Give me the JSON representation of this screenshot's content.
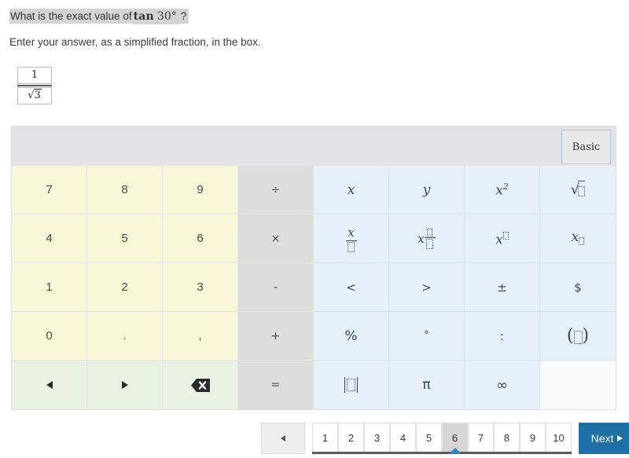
{
  "question": {
    "prefix": "What is the exact value of",
    "function": "tan",
    "angle": "30°",
    "qmark": "?",
    "instruction": "Enter your answer, as a simplified fraction, in the box."
  },
  "answer": {
    "numerator": "1",
    "denominator_radicand": "3",
    "denominator_prefix": "√"
  },
  "keypad": {
    "tab_label": "Basic",
    "rows": [
      [
        {
          "label": "7",
          "kind": "num",
          "name": "key-7"
        },
        {
          "label": "8",
          "kind": "num",
          "name": "key-8"
        },
        {
          "label": "9",
          "kind": "num",
          "name": "key-9"
        },
        {
          "label": "÷",
          "kind": "op",
          "name": "key-divide"
        },
        {
          "label": "x",
          "kind": "math",
          "name": "key-variable-x"
        },
        {
          "label": "y",
          "kind": "math",
          "name": "key-variable-y"
        },
        {
          "label": "x²",
          "kind": "math",
          "name": "key-x-squared"
        },
        {
          "label": "√□",
          "kind": "math",
          "name": "key-square-root"
        }
      ],
      [
        {
          "label": "4",
          "kind": "num",
          "name": "key-4"
        },
        {
          "label": "5",
          "kind": "num",
          "name": "key-5"
        },
        {
          "label": "6",
          "kind": "num",
          "name": "key-6"
        },
        {
          "label": "×",
          "kind": "op",
          "name": "key-multiply"
        },
        {
          "label": "x/□",
          "kind": "math",
          "name": "key-fraction-x-over-box"
        },
        {
          "label": "x □/□",
          "kind": "math",
          "name": "key-mixed-number"
        },
        {
          "label": "x^□",
          "kind": "math",
          "name": "key-exponent"
        },
        {
          "label": "x_□",
          "kind": "math",
          "name": "key-subscript"
        }
      ],
      [
        {
          "label": "1",
          "kind": "num",
          "name": "key-1"
        },
        {
          "label": "2",
          "kind": "num",
          "name": "key-2"
        },
        {
          "label": "3",
          "kind": "num",
          "name": "key-3"
        },
        {
          "label": "-",
          "kind": "op",
          "name": "key-minus"
        },
        {
          "label": "<",
          "kind": "math",
          "name": "key-less-than"
        },
        {
          "label": ">",
          "kind": "math",
          "name": "key-greater-than"
        },
        {
          "label": "±",
          "kind": "math",
          "name": "key-plus-minus"
        },
        {
          "label": "$",
          "kind": "math",
          "name": "key-dollar"
        }
      ],
      [
        {
          "label": "0",
          "kind": "num",
          "name": "key-0"
        },
        {
          "label": ".",
          "kind": "num",
          "name": "key-decimal-point"
        },
        {
          "label": ",",
          "kind": "num",
          "name": "key-comma"
        },
        {
          "label": "+",
          "kind": "op",
          "name": "key-plus"
        },
        {
          "label": "%",
          "kind": "math",
          "name": "key-percent"
        },
        {
          "label": "°",
          "kind": "math",
          "name": "key-degree"
        },
        {
          "label": ":",
          "kind": "math",
          "name": "key-colon"
        },
        {
          "label": "(□)",
          "kind": "math",
          "name": "key-parentheses"
        }
      ],
      [
        {
          "label": "◄",
          "kind": "nav",
          "name": "key-cursor-left"
        },
        {
          "label": "►",
          "kind": "nav",
          "name": "key-cursor-right"
        },
        {
          "label": "⌫",
          "kind": "nav",
          "name": "key-backspace"
        },
        {
          "label": "=",
          "kind": "op",
          "name": "key-equals"
        },
        {
          "label": "|□|",
          "kind": "math",
          "name": "key-absolute-value"
        },
        {
          "label": "π",
          "kind": "math",
          "name": "key-pi"
        },
        {
          "label": "∞",
          "kind": "math",
          "name": "key-infinity"
        },
        {
          "label": "",
          "kind": "blank",
          "name": "key-blank"
        }
      ]
    ]
  },
  "pagination": {
    "prev_label": "◄",
    "pages": [
      "1",
      "2",
      "3",
      "4",
      "5",
      "6",
      "7",
      "8",
      "9",
      "10"
    ],
    "active_page": "6",
    "next_label": "Next"
  },
  "colors": {
    "accent_blue": "#1d6fa5",
    "marker_blue": "#2e87c4",
    "number_key": "#f8f8d8",
    "operator_key": "#dddddd",
    "math_key": "#e6f0fa",
    "nav_key": "#eaf2e4",
    "highlight_gray": "#d4d4d4"
  }
}
